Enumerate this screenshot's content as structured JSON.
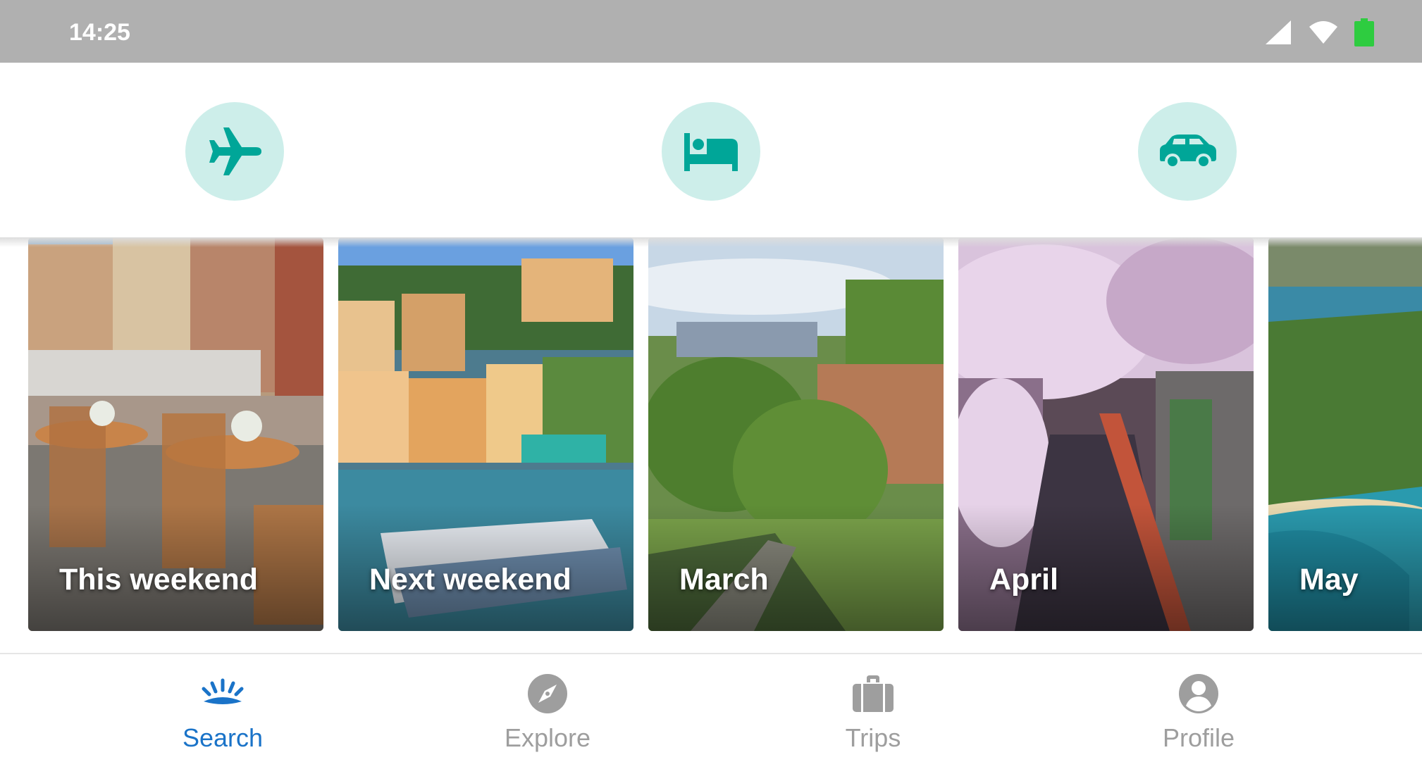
{
  "status_bar": {
    "time": "14:25",
    "icons": [
      "signal-icon",
      "wifi-icon",
      "battery-icon"
    ],
    "battery_color": "#2ecc40"
  },
  "verticals": [
    {
      "name": "flights",
      "icon": "airplane-icon"
    },
    {
      "name": "hotels",
      "icon": "bed-icon"
    },
    {
      "name": "cars",
      "icon": "car-icon"
    }
  ],
  "accent_color": "#00a698",
  "accent_bg": "#cdeeea",
  "cards": [
    {
      "label": "This weekend"
    },
    {
      "label": "Next weekend"
    },
    {
      "label": "March"
    },
    {
      "label": "April"
    },
    {
      "label": "May"
    }
  ],
  "bottom_nav": {
    "items": [
      {
        "label": "Search",
        "icon": "search-sun-icon",
        "active": true
      },
      {
        "label": "Explore",
        "icon": "compass-icon",
        "active": false
      },
      {
        "label": "Trips",
        "icon": "suitcase-icon",
        "active": false
      },
      {
        "label": "Profile",
        "icon": "profile-icon",
        "active": false
      }
    ],
    "active_color": "#1a73c8",
    "inactive_color": "#9e9e9e"
  }
}
